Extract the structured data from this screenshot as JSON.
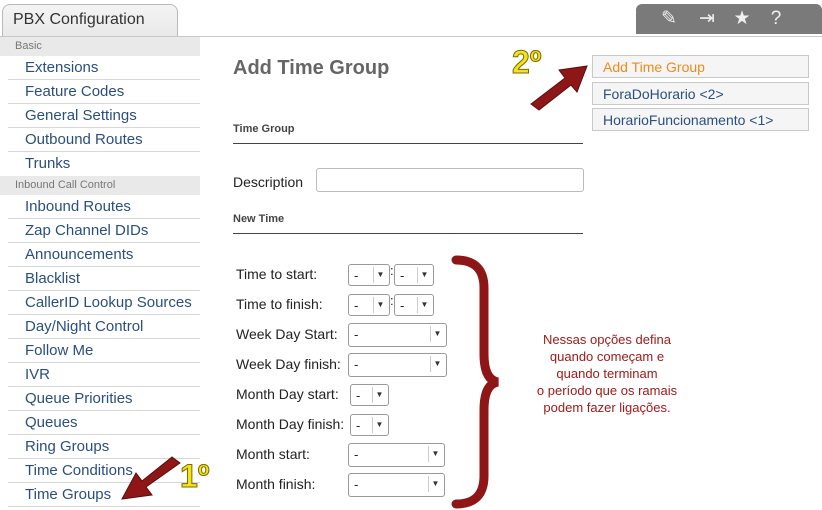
{
  "tab": {
    "title": "PBX Configuration"
  },
  "toolbar": {
    "icons": [
      "edit-icon",
      "logout-icon",
      "star-icon",
      "help-icon"
    ],
    "glyphs": {
      "edit": "✎",
      "logout": "⇥",
      "star": "★",
      "help": "?"
    }
  },
  "sidebar": {
    "section_basic": "Basic",
    "basic_items": [
      "Extensions",
      "Feature Codes",
      "General Settings",
      "Outbound Routes",
      "Trunks"
    ],
    "section_inbound": "Inbound Call Control",
    "inbound_items": [
      "Inbound Routes",
      "Zap Channel DIDs",
      "Announcements",
      "Blacklist",
      "CallerID Lookup Sources",
      "Day/Night Control",
      "Follow Me",
      "IVR",
      "Queue Priorities",
      "Queues",
      "Ring Groups",
      "Time Conditions",
      "Time Groups"
    ]
  },
  "main": {
    "title": "Add Time Group",
    "section_time_group": "Time Group",
    "description_label": "Description",
    "description_value": "",
    "section_new_time": "New Time",
    "fields": {
      "time_start": "Time to start:",
      "time_finish": "Time to finish:",
      "week_start": "Week Day Start:",
      "week_finish": "Week Day finish:",
      "month_day_start": "Month Day start:",
      "month_day_finish": "Month Day finish:",
      "month_start": "Month start:",
      "month_finish": "Month finish:"
    },
    "select_value": "-",
    "colon": ":"
  },
  "right_list": {
    "items": [
      "Add Time Group",
      "ForaDoHorario <2>",
      "HorarioFuncionamento <1>"
    ]
  },
  "annotations": {
    "note_lines": [
      "Nessas opções defina",
      "quando começam e",
      "quando terminam",
      "o período que os ramais",
      "podem fazer ligações."
    ],
    "step1": "1º",
    "step2": "2º"
  },
  "colors": {
    "link": "#2a4f7f",
    "active": "#f08a1c",
    "annotation": "#a11a1a",
    "arrow": "#8e1616",
    "ordinal": "#f5e31a"
  }
}
